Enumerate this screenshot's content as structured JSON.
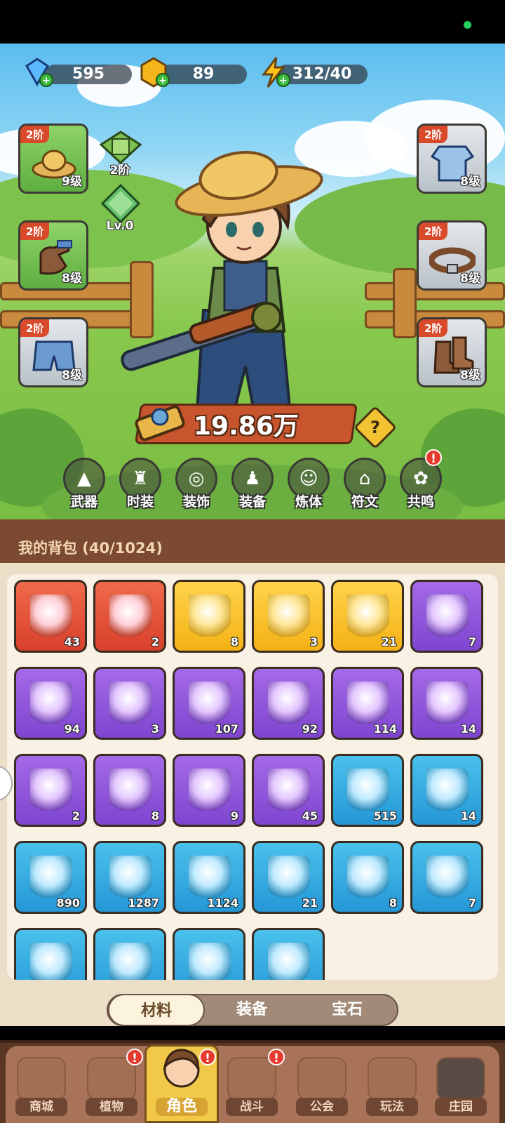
{
  "currency": {
    "diamonds": "595",
    "coins": "89",
    "energy": "312/40"
  },
  "equipment_left": [
    {
      "tier": "2阶",
      "level": "9级",
      "item": "straw-hat"
    },
    {
      "tier": "2阶",
      "level": "8级",
      "item": "gloves"
    },
    {
      "tier": "2阶",
      "level": "8级",
      "item": "shorts"
    }
  ],
  "equipment_right": [
    {
      "tier": "2阶",
      "level": "8级",
      "item": "shirt"
    },
    {
      "tier": "2阶",
      "level": "8级",
      "item": "belt"
    },
    {
      "tier": "2阶",
      "level": "8级",
      "item": "boots"
    }
  ],
  "extra_slots": {
    "card_tier": "2阶",
    "gem_level": "Lv.0"
  },
  "power": "19.86万",
  "help_symbol": "?",
  "functions": [
    {
      "label": "武器",
      "icon": "gun-icon"
    },
    {
      "label": "时装",
      "icon": "outfit-icon"
    },
    {
      "label": "装饰",
      "icon": "mask-icon"
    },
    {
      "label": "装备",
      "icon": "equipment-icon"
    },
    {
      "label": "炼体",
      "icon": "body-refine-icon"
    },
    {
      "label": "符文",
      "icon": "rune-icon"
    },
    {
      "label": "共鸣",
      "icon": "resonance-icon",
      "badge": "!"
    }
  ],
  "bag": {
    "title": "我的背包 (40/1024)",
    "items": [
      {
        "rarity": "red",
        "count": "43",
        "icon": "star-crystal-icon"
      },
      {
        "rarity": "red",
        "count": "2",
        "icon": "red-potion-icon"
      },
      {
        "rarity": "gold",
        "count": "8",
        "icon": "golden-seed-icon"
      },
      {
        "rarity": "gold",
        "count": "3",
        "icon": "orange-potion-icon"
      },
      {
        "rarity": "gold",
        "count": "21",
        "icon": "purple-book-icon"
      },
      {
        "rarity": "purple",
        "count": "7",
        "icon": "silver-key-icon"
      },
      {
        "rarity": "purple",
        "count": "94",
        "icon": "green-scroll-icon"
      },
      {
        "rarity": "purple",
        "count": "3",
        "icon": "purple-scroll-icon"
      },
      {
        "rarity": "purple",
        "count": "107",
        "icon": "teal-scroll-icon"
      },
      {
        "rarity": "purple",
        "count": "92",
        "icon": "red-scroll-icon"
      },
      {
        "rarity": "purple",
        "count": "114",
        "icon": "gold-scroll-icon"
      },
      {
        "rarity": "purple",
        "count": "14",
        "icon": "purple-potion-icon"
      },
      {
        "rarity": "purple",
        "count": "2",
        "icon": "blue-bud-icon"
      },
      {
        "rarity": "purple",
        "count": "8",
        "icon": "gold-drop-icon"
      },
      {
        "rarity": "purple",
        "count": "9",
        "icon": "pink-crystal-icon"
      },
      {
        "rarity": "purple",
        "count": "45",
        "icon": "blue-crystal-icon"
      },
      {
        "rarity": "blue",
        "count": "515",
        "icon": "green-orb-icon"
      },
      {
        "rarity": "blue",
        "count": "14",
        "icon": "purple-orb-icon"
      },
      {
        "rarity": "blue",
        "count": "890",
        "icon": "blue-orb-icon"
      },
      {
        "rarity": "blue",
        "count": "1287",
        "icon": "fire-orb-icon"
      },
      {
        "rarity": "blue",
        "count": "1124",
        "icon": "gold-orb-icon"
      },
      {
        "rarity": "blue",
        "count": "21",
        "icon": "blue-potion-icon"
      },
      {
        "rarity": "blue",
        "count": "8",
        "icon": "hat-blueprint-icon"
      },
      {
        "rarity": "blue",
        "count": "7",
        "icon": "shirt-blueprint-icon"
      },
      {
        "rarity": "blue",
        "count": "",
        "icon": "blueprint-icon"
      },
      {
        "rarity": "blue",
        "count": "",
        "icon": "blueprint-icon"
      },
      {
        "rarity": "blue",
        "count": "",
        "icon": "blueprint-icon"
      },
      {
        "rarity": "blue",
        "count": "",
        "icon": "blue-book-icon"
      }
    ]
  },
  "tabs": [
    "材料",
    "装备",
    "宝石"
  ],
  "active_tab": "材料",
  "nav": [
    {
      "label": "商城",
      "badge": ""
    },
    {
      "label": "植物",
      "badge": "!"
    },
    {
      "label": "角色",
      "badge": "!",
      "active": true
    },
    {
      "label": "战斗",
      "badge": "!"
    },
    {
      "label": "公会",
      "badge": ""
    },
    {
      "label": "玩法",
      "badge": ""
    },
    {
      "label": "庄园",
      "badge": ""
    }
  ],
  "colors": {
    "rarity_red": "#e0523a",
    "rarity_gold": "#f7c12a",
    "rarity_purple": "#8f55dc",
    "rarity_blue": "#33aee2",
    "brown_panel": "#7b4a31",
    "accent_gold": "#f1c848"
  }
}
